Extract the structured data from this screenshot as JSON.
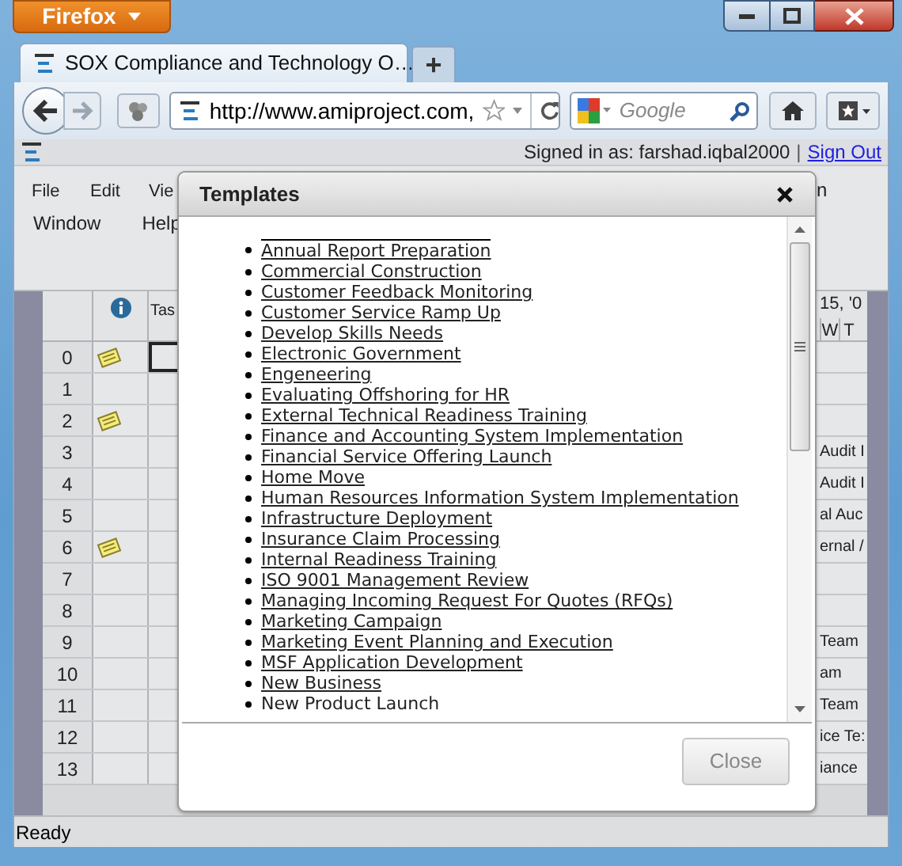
{
  "browser": {
    "menu_button": "Firefox",
    "tab_title": "SOX Compliance and Technology O…",
    "new_tab": "+",
    "url": "http://www.amiproject.com,",
    "search_placeholder": "Google"
  },
  "app": {
    "signed_in": "Signed in as: farshad.iqbal2000",
    "separator": "|",
    "sign_out": "Sign Out",
    "menu_row_1": [
      "File",
      "Edit",
      "Vie"
    ],
    "menu_row_2": [
      "Window",
      "Help"
    ],
    "corner_text": "n"
  },
  "grid": {
    "column_2": "Tas",
    "timeline_header": "15, '0",
    "days": [
      "W",
      "T"
    ],
    "rows": [
      {
        "number": "0",
        "note": true,
        "selected": true
      },
      {
        "number": "1",
        "note": false,
        "selected": false
      },
      {
        "number": "2",
        "note": true,
        "selected": false
      },
      {
        "number": "3",
        "note": false,
        "selected": false,
        "column_5": "Audit I"
      },
      {
        "number": "4",
        "note": false,
        "selected": false,
        "column_5": "Audit I"
      },
      {
        "number": "5",
        "note": false,
        "selected": false,
        "column_5": "al Auc"
      },
      {
        "number": "6",
        "note": true,
        "selected": false,
        "column_5": "ernal /"
      },
      {
        "number": "7",
        "note": false,
        "selected": false
      },
      {
        "number": "8",
        "note": false,
        "selected": false
      },
      {
        "number": "9",
        "note": false,
        "selected": false,
        "column_5": "Team"
      },
      {
        "number": "10",
        "note": false,
        "selected": false,
        "column_5": "am"
      },
      {
        "number": "11",
        "note": false,
        "selected": false,
        "column_5": "Team"
      },
      {
        "number": "12",
        "note": false,
        "selected": false,
        "column_5": "ice Te:"
      },
      {
        "number": "13",
        "note": false,
        "selected": false,
        "column_5": "iance"
      }
    ]
  },
  "dialog": {
    "title": "Templates",
    "close_button": "Close",
    "items": [
      {
        "label": "Annual Report Preparation",
        "underlined": true
      },
      {
        "label": "Commercial Construction",
        "underlined": true
      },
      {
        "label": "Customer Feedback Monitoring",
        "underlined": true
      },
      {
        "label": "Customer Service Ramp Up",
        "underlined": true
      },
      {
        "label": "Develop Skills Needs",
        "underlined": true
      },
      {
        "label": "Electronic Government",
        "underlined": true
      },
      {
        "label": "Engeneering",
        "underlined": true
      },
      {
        "label": "Evaluating Offshoring for HR",
        "underlined": true
      },
      {
        "label": "External Technical Readiness Training",
        "underlined": true
      },
      {
        "label": "Finance and Accounting System Implementation",
        "underlined": true
      },
      {
        "label": "Financial Service Offering Launch",
        "underlined": true
      },
      {
        "label": "Home Move",
        "underlined": true
      },
      {
        "label": "Human Resources Information System Implementation",
        "underlined": true
      },
      {
        "label": "Infrastructure Deployment",
        "underlined": true
      },
      {
        "label": "Insurance Claim Processing",
        "underlined": true
      },
      {
        "label": "Internal Readiness Training",
        "underlined": true
      },
      {
        "label": "ISO 9001 Management Review",
        "underlined": true
      },
      {
        "label": "Managing Incoming Request For Quotes (RFQs)",
        "underlined": true
      },
      {
        "label": "Marketing Campaign",
        "underlined": true
      },
      {
        "label": "Marketing Event Planning and Execution",
        "underlined": true
      },
      {
        "label": "MSF Application Development",
        "underlined": true
      },
      {
        "label": "New Business",
        "underlined": true
      },
      {
        "label": "New Product Launch",
        "underlined": false
      }
    ]
  },
  "status_bar": "Ready"
}
